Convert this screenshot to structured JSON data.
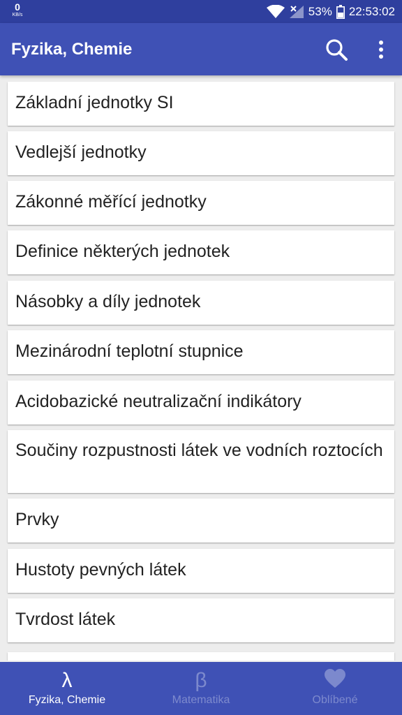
{
  "status_bar": {
    "net_speed_value": "0",
    "net_speed_unit": "KB/s",
    "battery": "53%",
    "time": "22:53:02"
  },
  "app_bar": {
    "title": "Fyzika, Chemie",
    "search_icon": "search-icon",
    "more_icon": "more-vert-icon"
  },
  "list": {
    "items": [
      "Základní jednotky SI",
      "Vedlejší jednotky",
      "Zákonné měřící jednotky",
      "Definice některých jednotek",
      "Násobky a díly jednotek",
      "Mezinárodní teplotní stupnice",
      "Acidobazické neutralizační indikátory",
      "Součiny rozpustnosti látek ve vodních roztocích",
      "Prvky",
      "Hustoty pevných látek",
      "Tvrdost látek"
    ]
  },
  "bottom_nav": {
    "tabs": [
      {
        "label": "Fyzika, Chemie",
        "icon_glyph": "λ",
        "active": true
      },
      {
        "label": "Matematika",
        "icon_glyph": "β",
        "active": false
      },
      {
        "label": "Oblíbené",
        "icon": "heart-icon",
        "active": false
      }
    ]
  },
  "colors": {
    "status_bar": "#2f3f9e",
    "primary": "#3f51b5",
    "background": "#ededed",
    "card": "#ffffff"
  }
}
